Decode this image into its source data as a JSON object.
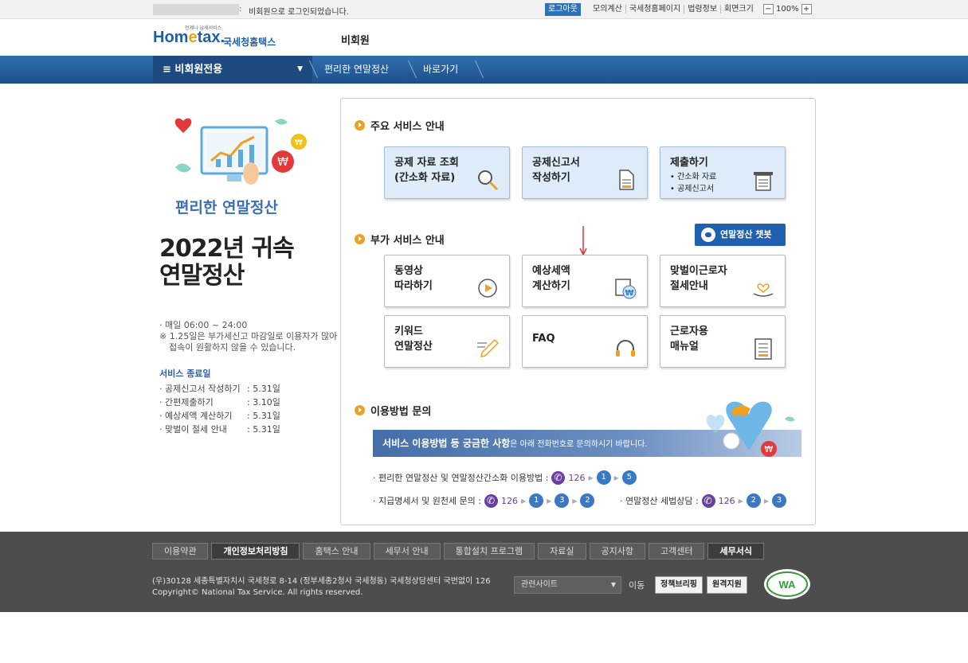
{
  "topbar": {
    "message": "비회원으로 로그인되었습니다.",
    "logout_label": "로그아웃",
    "links": [
      "모의계산",
      "국세청홈페이지",
      "법령정보",
      "회면크기"
    ],
    "zoom_value": "100%",
    "zoom_minus": "−",
    "zoom_plus": "+"
  },
  "header": {
    "logo_text_home": "Hom",
    "logo_text_e": "e",
    "logo_text_tax": "tax.",
    "logo_sub": "국세청홈택스",
    "logo_tiny": "언제나 납세서비스",
    "member_label": "비회원"
  },
  "nav": {
    "menu_label": "≡  비회원전용",
    "caret": "▼",
    "crumbs": [
      "편리한 연말정산",
      "바로가기"
    ]
  },
  "left": {
    "illus_title": "편리한 연말정산",
    "big_title_line1": "2022년 귀속",
    "big_title_line2": "연말정산",
    "hours": "· 매일 06:00  ~ 24:00",
    "note": "※ 1.25일은 부가세신고 마감일로 이용자가 많아 접속이 원활하지 않을 수 있습니다.",
    "end_title": "서비스 종료일",
    "end_items": [
      {
        "k": "· 공제신고서 작성하기",
        "v": ": 5.31일"
      },
      {
        "k": "· 간편제출하기",
        "v": ": 3.10일"
      },
      {
        "k": "· 예상세액 계산하기",
        "v": ": 5.31일"
      },
      {
        "k": "· 맞벌이 절세 안내",
        "v": ": 5.31일"
      }
    ]
  },
  "main": {
    "section1": "주요 서비스 안내",
    "tiles1": [
      {
        "line1": "공제 자료 조회",
        "line2": "(간소화 자료)"
      },
      {
        "line1": "공제신고서",
        "line2": "작성하기"
      },
      {
        "line1": "제출하기",
        "sub1": "• 간소화 자료",
        "sub2": "• 공제신고서"
      }
    ],
    "section2": "부가 서비스 안내",
    "chatbot_label": "연말정산 챗봇",
    "tiles2": [
      {
        "line1": "동영상",
        "line2": "따라하기"
      },
      {
        "line1": "예상세액",
        "line2": "계산하기"
      },
      {
        "line1": "맞벌이근로자",
        "line2": "절세안내"
      },
      {
        "line1": "키워드",
        "line2": "연말정산"
      },
      {
        "line1": "FAQ",
        "line2": ""
      },
      {
        "line1": "근로자용",
        "line2": "매뉴얼"
      }
    ],
    "section3": "이용방법 문의",
    "banner_strong": "서비스 이용방법 등 궁금한 사항",
    "banner_rest": "은 아래 전화번호로 문의하시기 바랍니다.",
    "contact1_label": "· 편리한 연말정산 및 연말정산간소화 이용방법 :",
    "contact1_steps": [
      "1",
      "5"
    ],
    "contact2_label": "· 지급명세서  및 원천세 문의 :",
    "contact2_steps": [
      "1",
      "3",
      "2"
    ],
    "contact3_label": "· 연말정산 세법상담  :",
    "contact3_steps": [
      "2",
      "3"
    ],
    "phone_number": "126"
  },
  "footer": {
    "links": [
      "이용약관",
      "개인정보처리방침",
      "홈택스 안내",
      "세무서 안내",
      "통합설치 프로그램",
      "자료실",
      "공지사항",
      "고객센터",
      "세무서식"
    ],
    "address": "(우)30128 세종특별자치시 국세청로 8-14 (정부세종2청사 국세청동) 국세청상담센터 국번없이 126",
    "copyright": "Copyright© National Tax Service. All rights reserved.",
    "related_label": "관련사이트",
    "go_label": "이동",
    "btn1": "정책브리핑",
    "btn2": "원격지원",
    "wa_text": "WA"
  },
  "colors": {
    "nav": "#1f4f8a",
    "accent": "#f0a020",
    "phone": "#6a3fa0",
    "step": "#3a78c4"
  }
}
